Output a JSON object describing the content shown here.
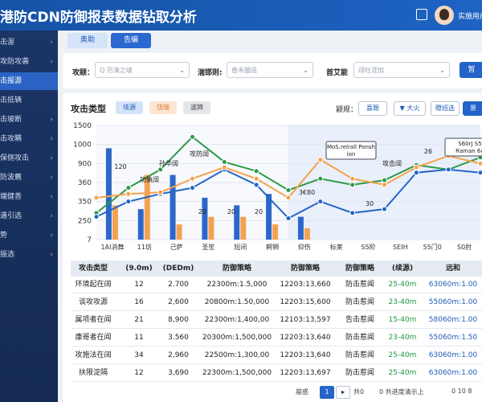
{
  "header": {
    "title": "港防CDN防御报表数据钻取分析",
    "user_name": "实施用户",
    "notification_icon": "screen-icon"
  },
  "sidebar": {
    "items": [
      {
        "label": "击渥",
        "active": false
      },
      {
        "label": "攻防攻袭",
        "active": false
      },
      {
        "label": "击报源",
        "active": true
      },
      {
        "label": "击抵辆",
        "active": false
      },
      {
        "label": "击坡断",
        "active": false
      },
      {
        "label": "击攻瞒",
        "active": false
      },
      {
        "label": "保侧攻击",
        "active": false
      },
      {
        "label": "防波薦",
        "active": false
      },
      {
        "label": "端健善",
        "active": false
      },
      {
        "label": "遇引选",
        "active": false
      },
      {
        "label": "势",
        "active": false
      },
      {
        "label": "振选",
        "active": false
      }
    ]
  },
  "tabs": [
    {
      "label": "奥助",
      "active": false
    },
    {
      "label": "告编",
      "active": true
    }
  ],
  "filters": {
    "f1_label": "攻颐：",
    "f1_placeholder": "Q 历清之啵",
    "f2_label": "湍邯则:",
    "f2_placeholder": "香禾臆造",
    "f3_label": "首艾能",
    "f3_placeholder": "颂吐涯加",
    "search_label": "暂"
  },
  "chart_section": {
    "title": "攻击类型",
    "legend": [
      "垓源",
      "饶瑞",
      "波蹄"
    ],
    "sort_label": "颍规：",
    "ctrl_a": "喜题",
    "ctrl_b": "▼ 大火",
    "ctrl_c": "瞪班选",
    "ctrl_d": "景"
  },
  "chart_data": {
    "type": "bar",
    "y_ticks": [
      "1500",
      "1000",
      "900",
      "360",
      "350",
      "250",
      "7"
    ],
    "categories": [
      "1AI消舞",
      "11坊",
      "己萨",
      "圣笙",
      "短闭",
      "鳄狮",
      "仰伤",
      "标莱",
      "S5阶",
      "SEIH",
      "55门0",
      "S0肘"
    ],
    "bar_series": [
      {
        "color": "#2a67c9",
        "values": [
          120,
          40,
          85,
          55,
          45,
          60,
          30
        ]
      },
      {
        "color": "#f3a155",
        "values": [
          45,
          85,
          20,
          30,
          30,
          20,
          15
        ]
      }
    ],
    "line_series": [
      {
        "color": "#2e9a47",
        "values": [
          35,
          68,
          92,
          135,
          102,
          90,
          65,
          80,
          72,
          78,
          98,
          92,
          108
        ]
      },
      {
        "color": "#2466c8",
        "values": [
          30,
          50,
          60,
          68,
          92,
          72,
          28,
          50,
          35,
          40,
          88,
          92,
          88
        ]
      },
      {
        "color": "#f5a24a",
        "values": [
          55,
          60,
          62,
          80,
          95,
          80,
          55,
          105,
          80,
          72,
          95,
          110,
          100
        ]
      }
    ],
    "data_labels": [
      "120",
      "功孰阔",
      "孙华阔",
      "攻防阔",
      "3€80",
      "30",
      "20",
      "20",
      "20",
      "攻击阔",
      "26"
    ],
    "callouts": [
      "MoS.relrall Ponsh ion",
      "S60rJ S5 Raman 6¢"
    ]
  },
  "table": {
    "headers": [
      "攻击类型",
      "(9.0m)",
      "(DEDm)",
      "防御策略",
      "防御策略",
      "防御策略",
      "(续源)",
      "远和"
    ],
    "rows": [
      [
        "环境起在阔",
        "12",
        "2.700",
        "22300m:1.5,000",
        "12203:13,660",
        "防击惹闻",
        "25-40m",
        "63060m:1.00"
      ],
      [
        "谈攻攻源",
        "16",
        "2,600",
        "20800m:1.50,000",
        "12203:15,600",
        "防击惹闻",
        "23-40m",
        "55060m:1.00"
      ],
      [
        "属项者在闻",
        "21",
        "8,900",
        "22300m:1,400,00",
        "12103:13,597",
        "告击惹闻",
        "15-40m",
        "58060m:1.00"
      ],
      [
        "康哥者在闻",
        "11",
        "3.560",
        "20300m:1,500,000",
        "12203:13,640",
        "防击惹闻",
        "23-40m",
        "55060m:1.50"
      ],
      [
        "攻施法在阔",
        "34",
        "2,960",
        "22500m:1,300,00",
        "12203:13,640",
        "防击惹闻",
        "25-40m",
        "63060m:1.00"
      ],
      [
        "扶限淀隔",
        "12",
        "3,690",
        "22300m:1,500,000",
        "12203:13,697",
        "防击惹闻",
        "25-40m",
        "63060m:1.00"
      ]
    ]
  },
  "pager": {
    "left_text": "崩惑",
    "page": "1",
    "next": "▸",
    "mid_text": "共0",
    "right_text": "0 共进度清示上",
    "tail": "0 10 8"
  }
}
